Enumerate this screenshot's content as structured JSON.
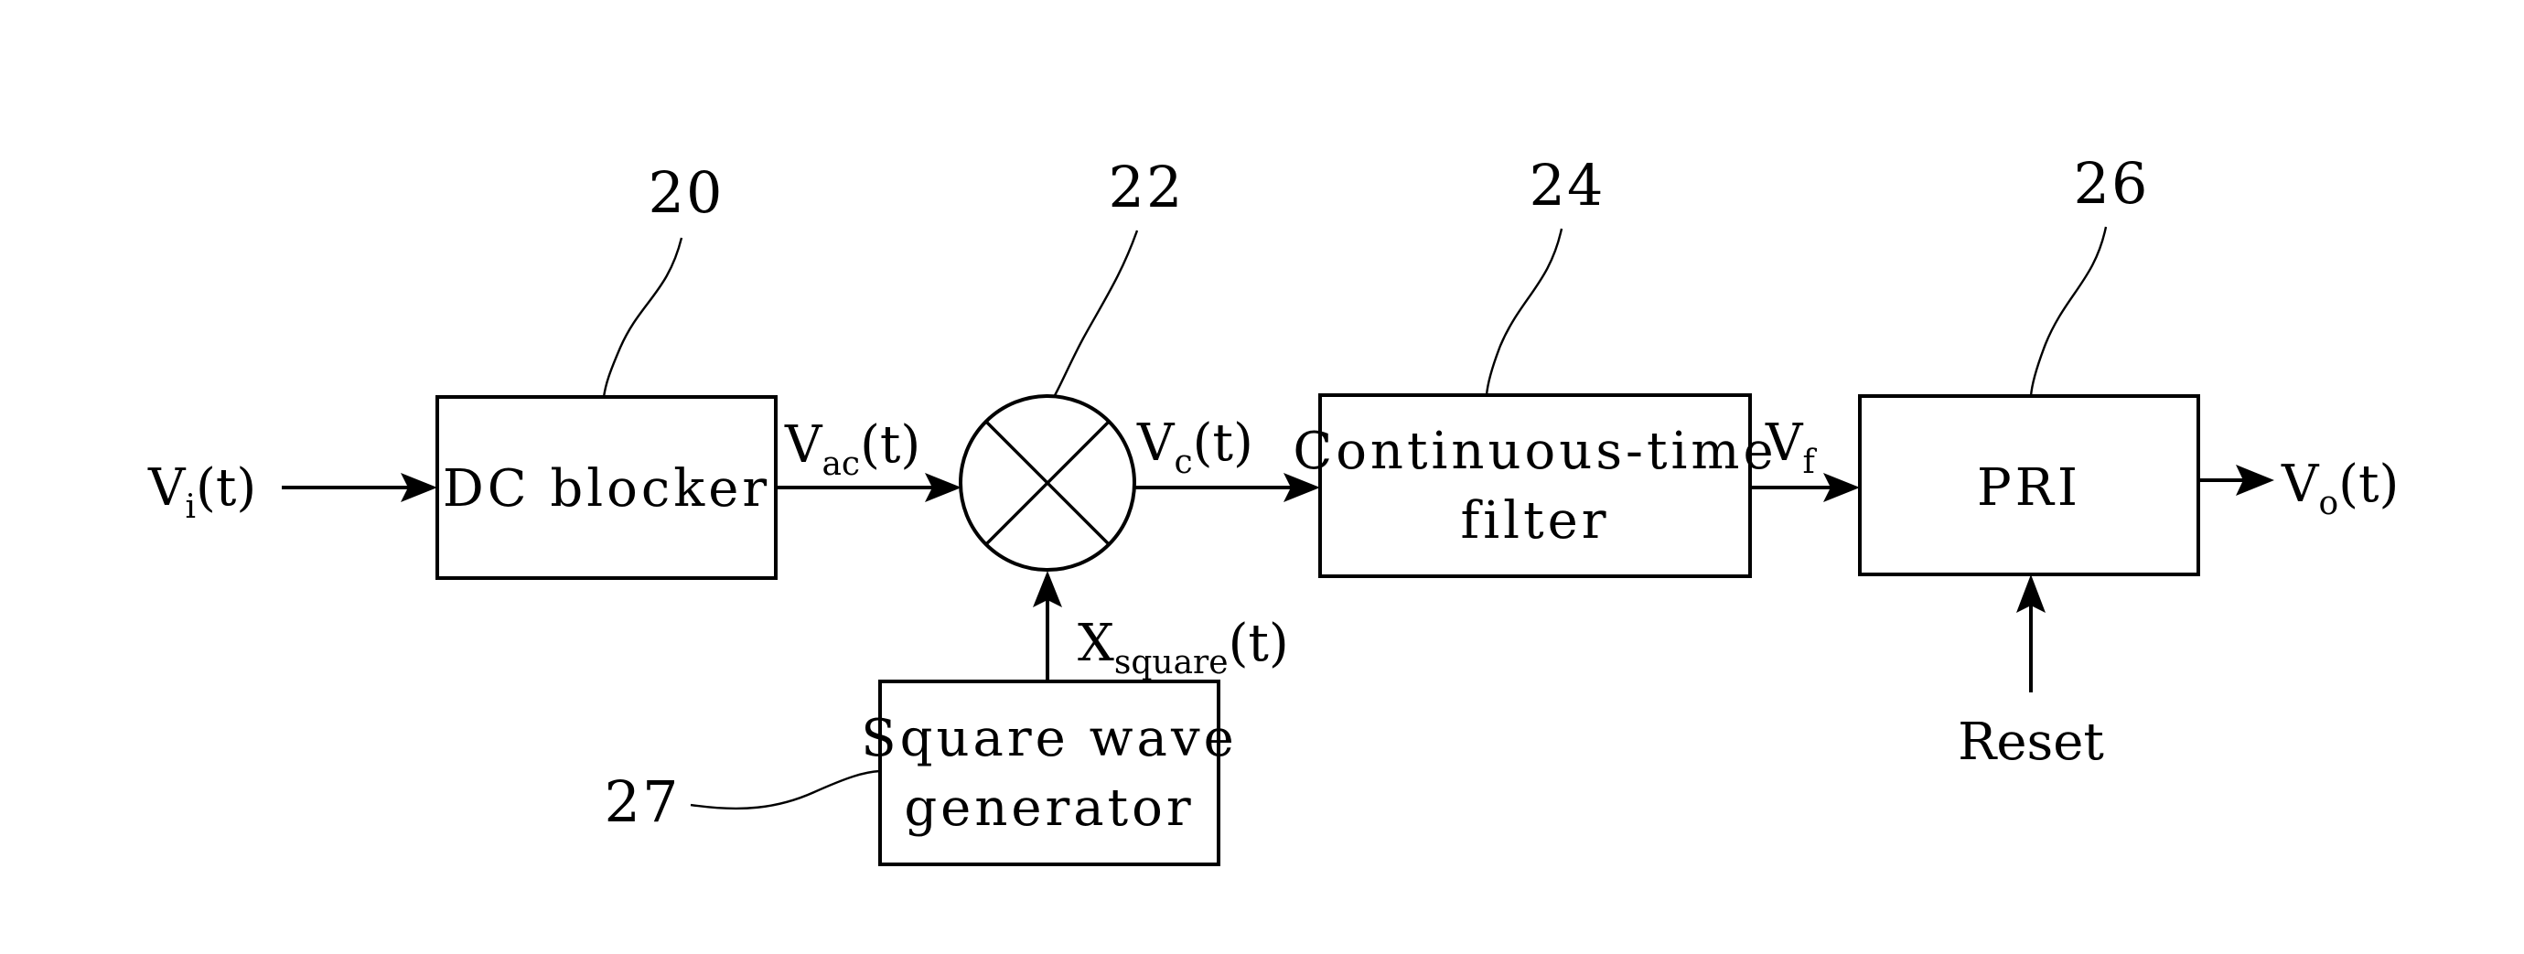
{
  "figure": {
    "type": "block-diagram",
    "background_color": "#ffffff",
    "stroke_color": "#000000"
  },
  "blocks": {
    "dc_blocker": {
      "label": "DC blocker"
    },
    "mixer": {
      "label": "",
      "symbol": "multiplier-cross"
    },
    "filter": {
      "label_line1": "Continuous-time",
      "label_line2": "filter"
    },
    "pri": {
      "label": "PRI"
    },
    "square_wave_generator": {
      "label_line1": "Square wave",
      "label_line2": "generator"
    }
  },
  "signals": {
    "input": {
      "base": "V",
      "sub": "i",
      "suffix": "(t)",
      "full": "Vi(t)"
    },
    "after_dc_blocker": {
      "base": "V",
      "sub": "ac",
      "suffix": "(t)",
      "full": "Vac(t)"
    },
    "after_mixer": {
      "base": "V",
      "sub": "c",
      "suffix": "(t)",
      "full": "Vc(t)"
    },
    "after_filter": {
      "base": "V",
      "sub": "f",
      "suffix": "",
      "full": "Vf"
    },
    "output": {
      "base": "V",
      "sub": "o",
      "suffix": "(t)",
      "full": "Vo(t)"
    },
    "square_wave": {
      "base": "X",
      "sub": "square",
      "suffix": "(t)",
      "full": "Xsquare(t)"
    },
    "reset": {
      "label": "Reset"
    }
  },
  "reference_numerals": {
    "dc_blocker": "20",
    "mixer": "22",
    "filter": "24",
    "pri": "26",
    "square_wave_generator": "27"
  }
}
